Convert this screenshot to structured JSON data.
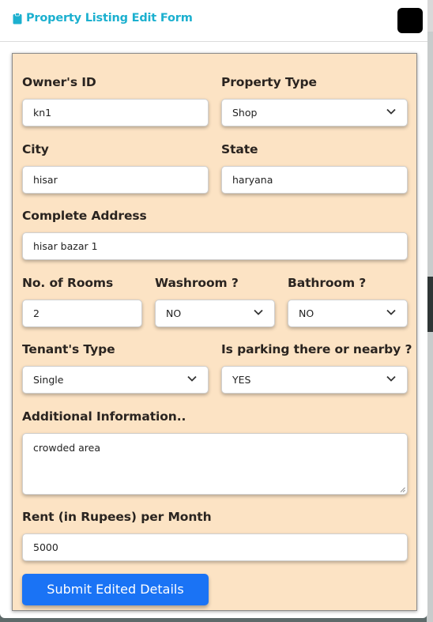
{
  "modal": {
    "title": "Property Listing Edit Form",
    "title_icon": "clipboard-icon",
    "close_icon": "close-icon"
  },
  "form": {
    "owner_id": {
      "label": "Owner's ID",
      "value": "kn1"
    },
    "property_type": {
      "label": "Property Type",
      "value": "Shop"
    },
    "city": {
      "label": "City",
      "value": "hisar"
    },
    "state": {
      "label": "State",
      "value": "haryana"
    },
    "address": {
      "label": "Complete Address",
      "value": "hisar bazar 1"
    },
    "rooms": {
      "label": "No. of Rooms",
      "value": "2"
    },
    "washroom": {
      "label": "Washroom ?",
      "value": "NO"
    },
    "bathroom": {
      "label": "Bathroom ?",
      "value": "NO"
    },
    "tenant_type": {
      "label": "Tenant's Type",
      "value": "Single"
    },
    "parking": {
      "label": "Is parking there or nearby ?",
      "value": "YES"
    },
    "additional_info": {
      "label": "Additional Information..",
      "value": "crowded area"
    },
    "rent": {
      "label": "Rent (in Rupees) per Month",
      "value": "5000"
    },
    "submit_label": "Submit Edited Details"
  },
  "colors": {
    "accent_title": "#1cb0cf",
    "form_background": "#fce3c4",
    "submit_button": "#1a73f5"
  }
}
